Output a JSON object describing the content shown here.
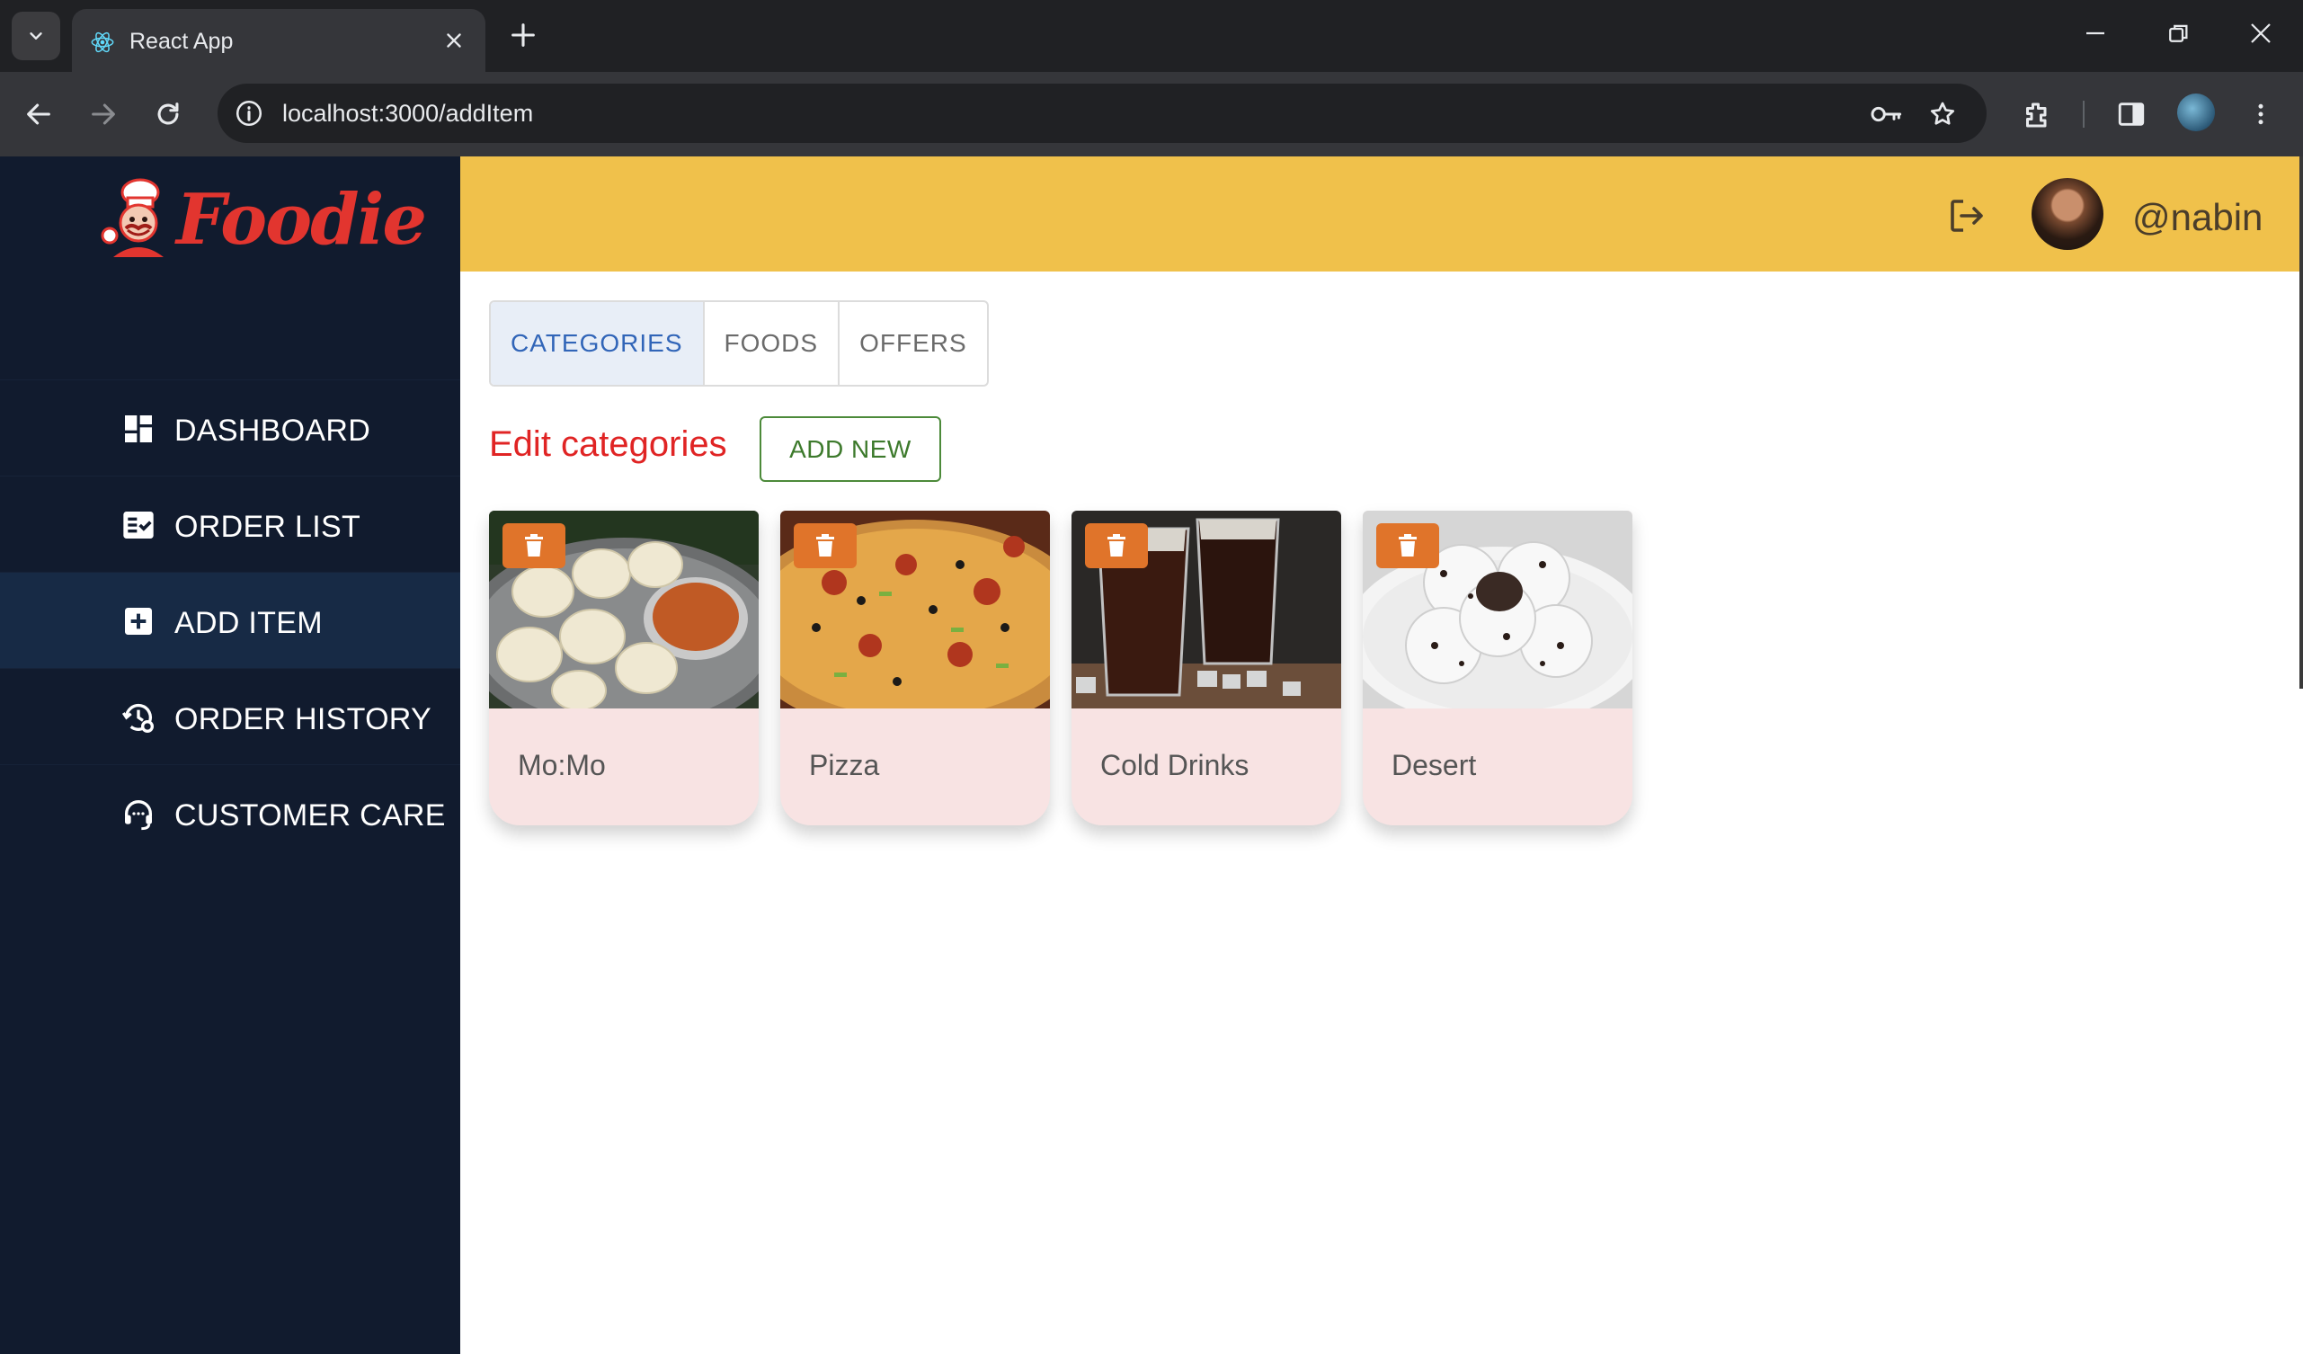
{
  "browser": {
    "tab_title": "React App",
    "url": "localhost:3000/addItem"
  },
  "app": {
    "logo_text": "Foodie",
    "user": {
      "handle": "@nabin"
    },
    "sidebar": {
      "items": [
        {
          "label": "DASHBOARD",
          "icon": "dashboard-icon",
          "active": false
        },
        {
          "label": "ORDER LIST",
          "icon": "order-list-icon",
          "active": false
        },
        {
          "label": "ADD ITEM",
          "icon": "add-box-icon",
          "active": true
        },
        {
          "label": "ORDER HISTORY",
          "icon": "history-settings-icon",
          "active": false
        },
        {
          "label": "CUSTOMER CARE",
          "icon": "headset-icon",
          "active": false
        }
      ]
    },
    "tabs": [
      {
        "label": "CATEGORIES",
        "selected": true
      },
      {
        "label": "FOODS",
        "selected": false
      },
      {
        "label": "OFFERS",
        "selected": false
      }
    ],
    "section_title": "Edit categories",
    "add_new_label": "ADD NEW",
    "categories": [
      {
        "name": "Mo:Mo",
        "image": "momo-dumplings-photo"
      },
      {
        "name": "Pizza",
        "image": "pizza-photo"
      },
      {
        "name": "Cold Drinks",
        "image": "cola-glasses-photo"
      },
      {
        "name": "Desert",
        "image": "oreo-truffles-photo"
      }
    ],
    "colors": {
      "sidebar_bg": "#111b2e",
      "topbar_bg": "#f0c14b",
      "title_red": "#e02424",
      "delete_orange": "#e0742a",
      "card_bg": "#f8e3e3"
    }
  }
}
